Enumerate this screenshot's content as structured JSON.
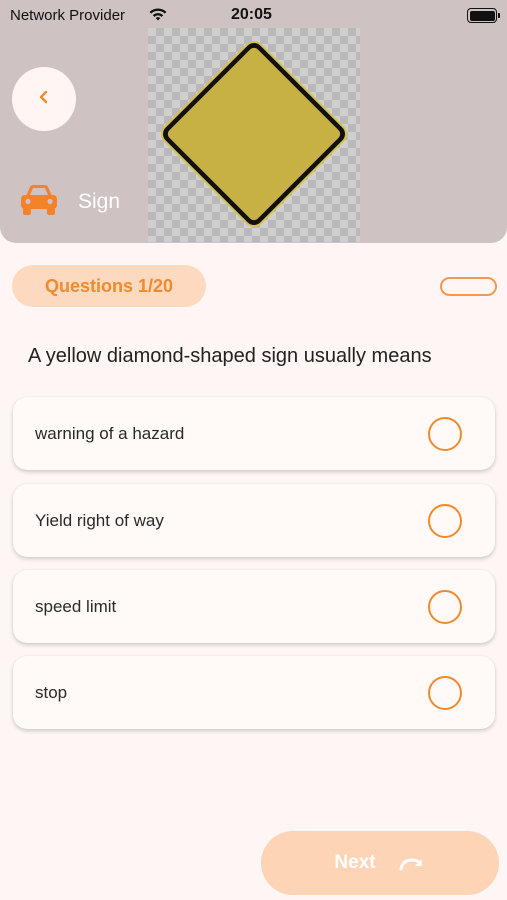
{
  "status_bar": {
    "provider": "Network Provider",
    "time": "20:05",
    "icons": [
      "wifi-icon",
      "battery-icon"
    ]
  },
  "header": {
    "back_icon": "chevron-left-icon",
    "category_icon": "car-icon",
    "category_label": "Sign",
    "sign_image": "yellow-diamond-sign"
  },
  "progress": {
    "label": "Questions 1/20"
  },
  "question": {
    "text": "A yellow diamond-shaped sign usually means",
    "options": [
      {
        "label": "warning of a hazard"
      },
      {
        "label": "Yield right of way"
      },
      {
        "label": "speed limit"
      },
      {
        "label": "stop"
      }
    ]
  },
  "next_button": {
    "label": "Next",
    "icon": "redo-arrow-icon"
  },
  "colors": {
    "accent": "#f08a2c",
    "header_bg": "#cfc2c3",
    "sign_yellow": "#c7b044",
    "pill_bg": "#fdd9bf",
    "next_bg": "#fdd4b6"
  }
}
